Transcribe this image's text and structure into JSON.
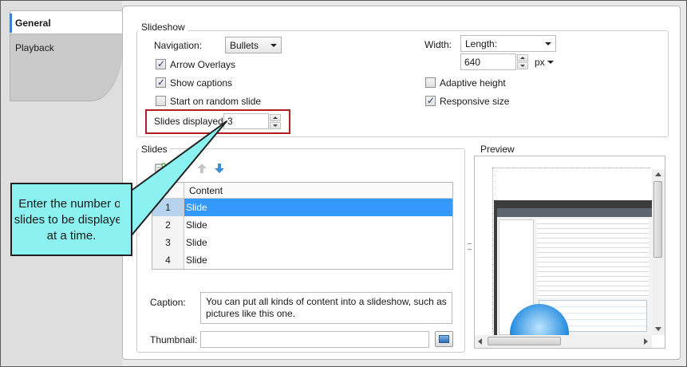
{
  "tabs": [
    {
      "label": "General",
      "active": true
    },
    {
      "label": "Playback",
      "active": false
    }
  ],
  "slideshow": {
    "group_title": "Slideshow",
    "navigation_label": "Navigation:",
    "navigation_value": "Bullets",
    "arrow_overlays_label": "Arrow Overlays",
    "arrow_overlays_checked": true,
    "show_captions_label": "Show captions",
    "show_captions_checked": true,
    "start_random_label": "Start on random slide",
    "start_random_checked": false,
    "slides_displayed_label": "Slides displayed:",
    "slides_displayed_value": "3",
    "width_label": "Width:",
    "width_mode": "Length:",
    "width_value": "640",
    "width_unit": "px",
    "adaptive_height_label": "Adaptive height",
    "adaptive_height_checked": false,
    "responsive_size_label": "Responsive size",
    "responsive_size_checked": true
  },
  "slides": {
    "group_title": "Slides",
    "toolbar_icons": [
      "add-slide-icon",
      "delete-slide-icon",
      "move-up-icon",
      "move-down-icon"
    ],
    "column_header": "Content",
    "rows": [
      {
        "num": "1",
        "content": "Slide",
        "selected": true
      },
      {
        "num": "2",
        "content": "Slide",
        "selected": false
      },
      {
        "num": "3",
        "content": "Slide",
        "selected": false
      },
      {
        "num": "4",
        "content": "Slide",
        "selected": false
      }
    ],
    "caption_label": "Caption:",
    "caption_value": "You can put all kinds of content into a slideshow, such as pictures like this one.",
    "thumbnail_label": "Thumbnail:",
    "thumbnail_value": ""
  },
  "preview": {
    "group_title": "Preview"
  },
  "callout": {
    "text": "Enter the number of slides to be displayed at a time."
  },
  "colors": {
    "selection": "#3399ff",
    "callout_fill": "#8cf1f1",
    "highlight_border": "#b51e1e"
  }
}
